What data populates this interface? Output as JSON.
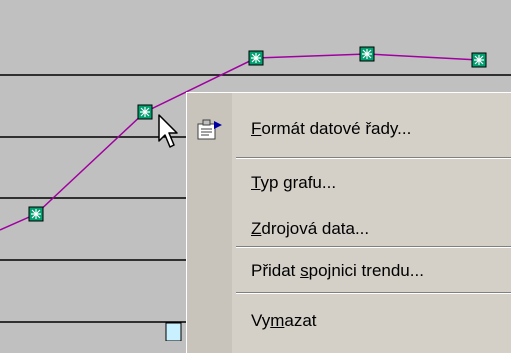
{
  "chart": {
    "line_color": "#a000a0",
    "marker_fill": "#00a070",
    "marker_glyph": "✱",
    "gridline_color": "#000000",
    "background_color": "#c0c0c0"
  },
  "context_menu": {
    "items": [
      {
        "id": "format",
        "prefix": "",
        "key": "F",
        "suffix": "ormát datové řady...",
        "icon": "format-data-series-icon"
      },
      {
        "id": "type",
        "prefix": "",
        "key": "T",
        "suffix": "yp grafu...",
        "icon": ""
      },
      {
        "id": "source",
        "prefix": "",
        "key": "Z",
        "suffix": "drojová data...",
        "icon": ""
      },
      {
        "id": "trend",
        "prefix": "Přidat ",
        "key": "s",
        "suffix": "pojnici trendu...",
        "icon": ""
      },
      {
        "id": "delete",
        "prefix": "Vy",
        "key": "m",
        "suffix": "azat",
        "icon": ""
      }
    ],
    "background_color": "#d4d0c8"
  },
  "cursor": {
    "icon": "arrow-cursor-icon"
  }
}
